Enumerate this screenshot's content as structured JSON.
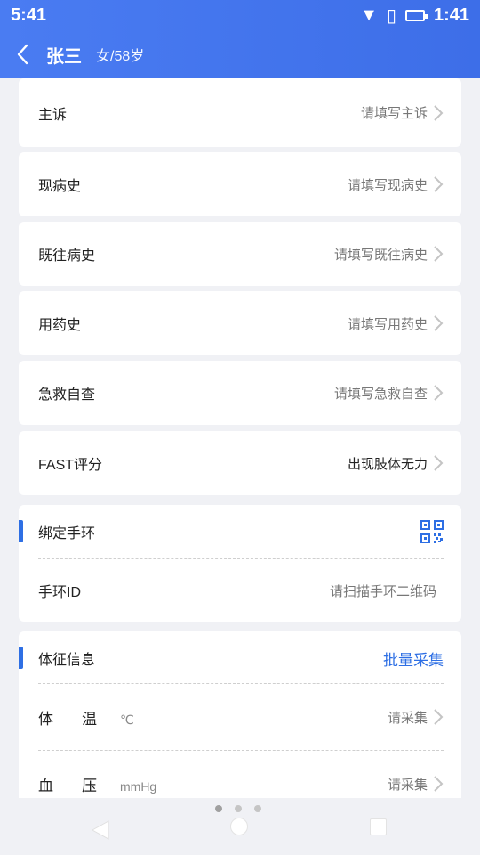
{
  "status_bar": {
    "time": "5:41",
    "clock": "1:41"
  },
  "header": {
    "name": "张三",
    "info": "女/58岁"
  },
  "records": [
    {
      "label": "主诉",
      "value": "请填写主诉",
      "filled": false
    },
    {
      "label": "现病史",
      "value": "请填写现病史",
      "filled": false
    },
    {
      "label": "既往病史",
      "value": "请填写既往病史",
      "filled": false
    },
    {
      "label": "用药史",
      "value": "请填写用药史",
      "filled": false
    },
    {
      "label": "急救自查",
      "value": "请填写急救自查",
      "filled": false
    },
    {
      "label": "FAST评分",
      "value": "出现肢体无力",
      "filled": true
    }
  ],
  "bracelet": {
    "title": "绑定手环",
    "id_label": "手环ID",
    "id_placeholder": "请扫描手环二维码"
  },
  "vitals": {
    "title": "体征信息",
    "batch_label": "批量采集",
    "items": [
      {
        "name": "体温",
        "unit": "℃",
        "action": "请采集"
      },
      {
        "name": "血压",
        "unit": "mmHg",
        "action": "请采集"
      }
    ]
  },
  "colors": {
    "primary": "#3d6ee8",
    "accent": "#2e6fe4",
    "background": "#f0f1f5"
  }
}
